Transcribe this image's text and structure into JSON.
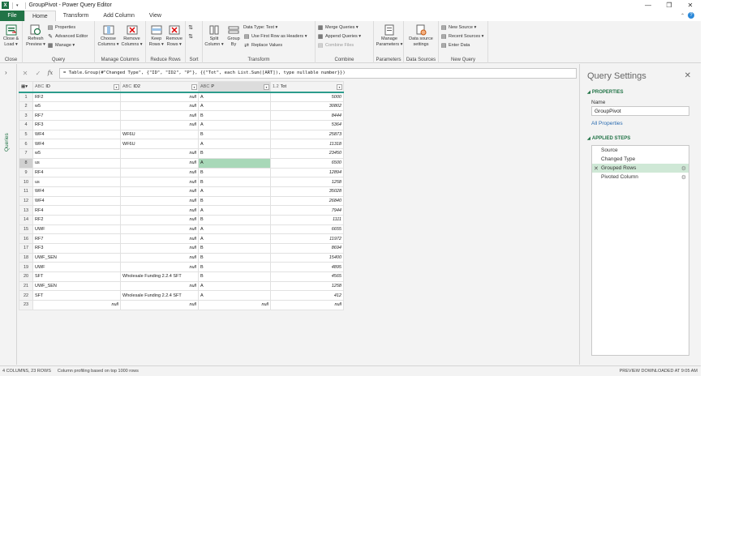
{
  "titlebar": {
    "title": "GroupPivot - Power Query Editor",
    "logo": "X",
    "quick_access": "▾"
  },
  "tabs": [
    "File",
    "Home",
    "Transform",
    "Add Column",
    "View"
  ],
  "ribbon": {
    "close": {
      "btn": "Close &\nLoad ▾",
      "label": "Close"
    },
    "query": {
      "refresh": "Refresh\nPreview ▾",
      "properties": "Properties",
      "advanced": "Advanced Editor",
      "manage": "Manage ▾",
      "label": "Query"
    },
    "manage_columns": {
      "choose": "Choose\nColumns ▾",
      "remove": "Remove\nColumns ▾",
      "label": "Manage Columns"
    },
    "reduce_rows": {
      "keep": "Keep\nRows ▾",
      "remove": "Remove\nRows ▾",
      "label": "Reduce Rows"
    },
    "sort": {
      "label": "Sort"
    },
    "transform": {
      "split": "Split\nColumn ▾",
      "group": "Group\nBy",
      "datatype": "Data Type: Text ▾",
      "firstrow": "Use First Row as Headers ▾",
      "replace": "Replace Values",
      "label": "Transform"
    },
    "combine": {
      "merge": "Merge Queries ▾",
      "append": "Append Queries ▾",
      "files": "Combine Files",
      "label": "Combine"
    },
    "parameters": {
      "manage": "Manage\nParameters ▾",
      "label": "Parameters"
    },
    "datasources": {
      "settings": "Data source\nsettings",
      "label": "Data Sources"
    },
    "newquery": {
      "newsource": "New Source ▾",
      "recent": "Recent Sources ▾",
      "enter": "Enter Data",
      "label": "New Query"
    }
  },
  "sidebar": {
    "label": "Queries",
    "expand": "›"
  },
  "formula": "= Table.Group(#\"Changed Type\", {\"ID\", \"ID2\", \"P\"}, {{\"Tot\", each List.Sum([ART]), type nullable number}})",
  "grid": {
    "columns": [
      {
        "type": "ABC",
        "name": "ID"
      },
      {
        "type": "ABC",
        "name": "ID2"
      },
      {
        "type": "ABC",
        "name": "P"
      },
      {
        "type": "1.2",
        "name": "Tot"
      }
    ],
    "rows": [
      [
        "1",
        "RF2",
        "null",
        "A",
        "5000"
      ],
      [
        "2",
        "w5",
        "null",
        "A",
        "30802"
      ],
      [
        "3",
        "RF7",
        "null",
        "B",
        "8444"
      ],
      [
        "4",
        "RF3",
        "null",
        "A",
        "5364"
      ],
      [
        "5",
        "WF4",
        "WF6U",
        "B",
        "25873"
      ],
      [
        "6",
        "WF4",
        "WF6U",
        "A",
        "11318"
      ],
      [
        "7",
        "w5",
        "null",
        "B",
        "23450"
      ],
      [
        "8",
        "us",
        "null",
        "A",
        "6500"
      ],
      [
        "9",
        "RF4",
        "null",
        "B",
        "12894"
      ],
      [
        "10",
        "us",
        "null",
        "B",
        "1258"
      ],
      [
        "11",
        "WF4",
        "null",
        "A",
        "35028"
      ],
      [
        "12",
        "WF4",
        "null",
        "B",
        "26840"
      ],
      [
        "13",
        "RF4",
        "null",
        "A",
        "7944"
      ],
      [
        "14",
        "RF2",
        "null",
        "B",
        "1111"
      ],
      [
        "15",
        "UWF",
        "null",
        "A",
        "6655"
      ],
      [
        "16",
        "RF7",
        "null",
        "A",
        "11972"
      ],
      [
        "17",
        "RF3",
        "null",
        "B",
        "8694"
      ],
      [
        "18",
        "UWF_SEN",
        "null",
        "B",
        "15400"
      ],
      [
        "19",
        "UWF",
        "null",
        "B",
        "4895"
      ],
      [
        "20",
        "SFT",
        "Wholesale Funding 2.2.4 SFT",
        "B",
        "4565"
      ],
      [
        "21",
        "UWF_SEN",
        "null",
        "A",
        "1258"
      ],
      [
        "22",
        "SFT",
        "Wholesale Funding 2.2.4 SFT",
        "A",
        "412"
      ],
      [
        "23",
        "null",
        "null",
        "null",
        "null"
      ]
    ]
  },
  "query_settings": {
    "title": "Query Settings",
    "close": "✕",
    "properties_label": "PROPERTIES",
    "name_label": "Name",
    "name_value": "GroupPivot",
    "all_properties": "All Properties",
    "steps_label": "APPLIED STEPS",
    "steps": [
      "Source",
      "Changed Type",
      "Grouped Rows",
      "Pivoted Column"
    ]
  },
  "status": {
    "left": "4 COLUMNS, 23 ROWS",
    "mid": "Column profiling based on top 1000 rows",
    "right": "PREVIEW DOWNLOADED AT 9:05 AM"
  },
  "colors": {
    "excel_green": "#217346",
    "header_accent": "#2c9c8c",
    "selected_cell": "#a8d8b8"
  }
}
